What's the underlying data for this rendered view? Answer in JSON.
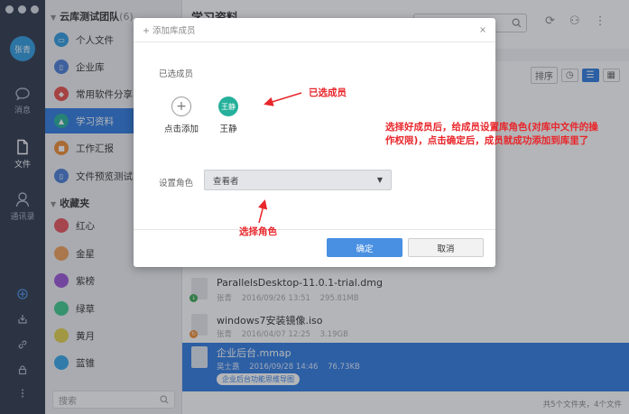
{
  "rail": {
    "avatar_text": "张青",
    "nav": [
      {
        "label": "消息",
        "icon": "message-icon"
      },
      {
        "label": "文件",
        "icon": "file-icon"
      },
      {
        "label": "通讯录",
        "icon": "contacts-icon"
      }
    ],
    "bottom_icons": [
      "add-icon",
      "inbox-icon",
      "link-icon",
      "lock-icon",
      "more-icon"
    ]
  },
  "sidebar": {
    "team_title": "云库测试团队",
    "team_count": "(6)",
    "libraries": [
      {
        "label": "个人文件",
        "color": "#2f9be0"
      },
      {
        "label": "企业库",
        "color": "#4a7ed8"
      },
      {
        "label": "常用软件分享",
        "color": "#e8514b"
      },
      {
        "label": "学习资料",
        "color": "#25b09b"
      },
      {
        "label": "工作汇报",
        "color": "#f08c34"
      },
      {
        "label": "文件预览测试",
        "color": "#4a7ed8"
      }
    ],
    "favorites_title": "收藏夹",
    "favorites": [
      {
        "label": "红心",
        "color": "#e8545c"
      },
      {
        "label": "金星",
        "color": "#f0a05a"
      },
      {
        "label": "紫榜",
        "color": "#9b55d8"
      },
      {
        "label": "绿草",
        "color": "#3fc98e"
      },
      {
        "label": "黄月",
        "color": "#e3d24c"
      },
      {
        "label": "蓝锥",
        "color": "#35a7ea"
      }
    ],
    "search_placeholder": "搜索"
  },
  "main": {
    "title": "学习资料",
    "sort_label": "排序",
    "files": [
      {
        "name": "ParallelsDesktop-11.0.1-trial.dmg",
        "owner": "张青",
        "date": "2016/09/26 13:51",
        "size": "295.81MB",
        "badge_color": "#3aaa55"
      },
      {
        "name": "windows7安装镜像.iso",
        "owner": "张青",
        "date": "2016/04/07 12:25",
        "size": "3.19GB",
        "badge_color": "#f08c34"
      },
      {
        "name": "企业后台.mmap",
        "owner": "吴士嘉",
        "date": "2016/09/28 14:46",
        "size": "76.73KB",
        "tag": "企业后台功能思维导图"
      }
    ],
    "status": "共5个文件夹，4个文件"
  },
  "dialog": {
    "title": "添加库成员",
    "selected_label": "已选成员",
    "add_label": "点击添加",
    "member_avatar": "王静",
    "member_name": "王静",
    "role_label": "设置角色",
    "role_value": "查看者",
    "ok": "确定",
    "cancel": "取消"
  },
  "annotations": {
    "selected_members": "已选成员",
    "instruction": "选择好成员后，给成员设置库角色(对库中文件的操作权限)，点击确定后，成员就成功添加到库里了",
    "choose_role": "选择角色"
  }
}
